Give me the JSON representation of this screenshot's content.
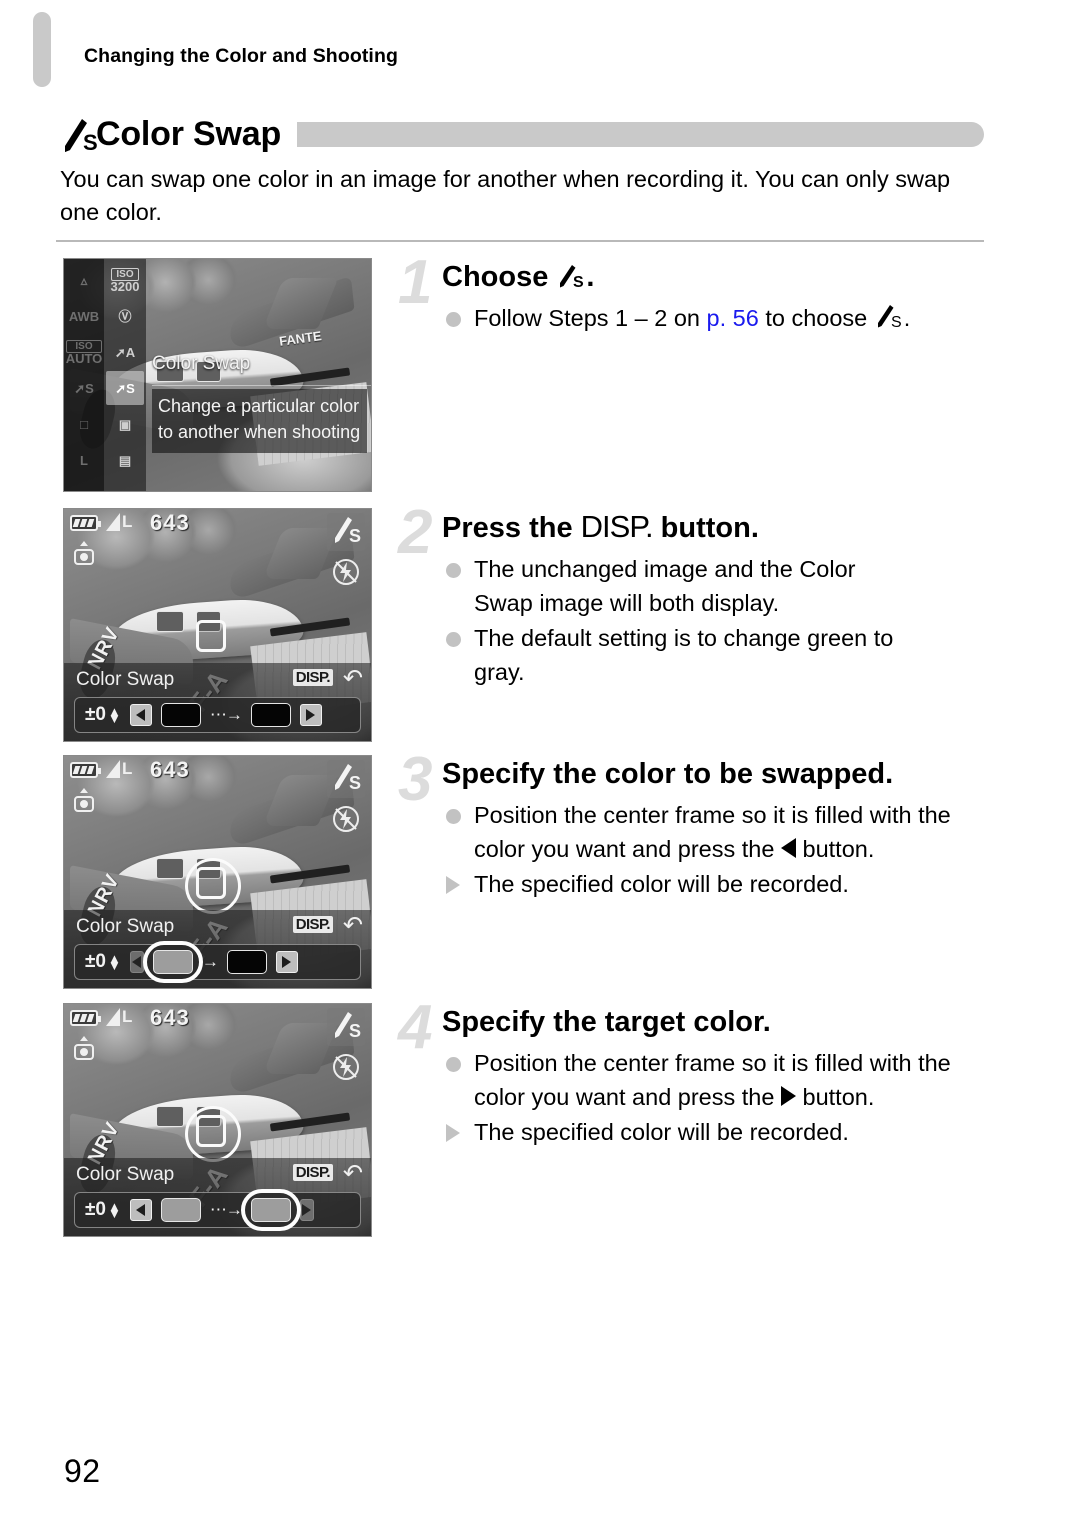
{
  "header": {
    "running_head": "Changing the Color and Shooting"
  },
  "section": {
    "icon_name": "color-swap-icon",
    "title": "Color Swap",
    "intro": "You can swap one color in an image for another when recording it. You can only swap one color."
  },
  "steps": [
    {
      "number": "1",
      "heading_prefix": "Choose",
      "heading_suffix": ".",
      "bullets": [
        {
          "type": "dot",
          "before": "Follow Steps 1 – 2 on ",
          "link": "p. 56",
          "middle": " to choose ",
          "after": "."
        }
      ]
    },
    {
      "number": "2",
      "heading_before": "Press the ",
      "heading_key": "DISP.",
      "heading_after": " button.",
      "bullets": [
        {
          "type": "dot",
          "text": "The unchanged image and the Color Swap image will both display."
        },
        {
          "type": "dot",
          "text": "The default setting is to change green to gray."
        }
      ]
    },
    {
      "number": "3",
      "heading": "Specify the color to be swapped.",
      "bullets": [
        {
          "type": "dot",
          "before": "Position the center frame so it is filled with the color you want and press the ",
          "button": "left-arrow",
          "after": " button."
        },
        {
          "type": "triangle",
          "text": "The specified color will be recorded."
        }
      ]
    },
    {
      "number": "4",
      "heading": "Specify the target color.",
      "bullets": [
        {
          "type": "dot",
          "before": "Position the center frame so it is filled with the color you want and press the ",
          "button": "right-arrow",
          "after": " button."
        },
        {
          "type": "triangle",
          "text": "The specified color will be recorded."
        }
      ]
    }
  ],
  "screenshots": [
    {
      "id": "menu-screen",
      "menu_column_left": [
        "AWB",
        "ISO AUTO",
        "swap-S",
        "single-frame",
        "L"
      ],
      "menu_column_right": [
        "ISO 3200",
        "D",
        "swap-A",
        "swap-S",
        "burst-1",
        "burst-2"
      ],
      "selected_item": "swap-S",
      "menu_title": "Color Swap",
      "menu_description": "Change a particular color to another when shooting"
    },
    {
      "id": "live-view-default",
      "battery": "battery-icon",
      "quality": "L",
      "shots_remaining": "643",
      "mode_icon": "color-swap-icon",
      "flash_icon": "flash-off-icon",
      "label": "Color Swap",
      "disp_badge": "DISP.",
      "return_icon": "return-arrow-icon",
      "ev": "±0",
      "source_swatch": "black",
      "target_swatch": "black",
      "selected_swatch": "none"
    },
    {
      "id": "live-view-source-selected",
      "battery": "battery-icon",
      "quality": "L",
      "shots_remaining": "643",
      "mode_icon": "color-swap-icon",
      "flash_icon": "flash-off-icon",
      "label": "Color Swap",
      "disp_badge": "DISP.",
      "return_icon": "return-arrow-icon",
      "ev": "±0",
      "source_swatch": "gray",
      "target_swatch": "black",
      "selected_swatch": "source"
    },
    {
      "id": "live-view-target-selected",
      "battery": "battery-icon",
      "quality": "L",
      "shots_remaining": "643",
      "mode_icon": "color-swap-icon",
      "flash_icon": "flash-off-icon",
      "label": "Color Swap",
      "disp_badge": "DISP.",
      "return_icon": "return-arrow-icon",
      "ev": "±0",
      "source_swatch": "gray",
      "target_swatch": "gray",
      "selected_swatch": "target"
    }
  ],
  "plane_markings": {
    "left_wing": "NRV",
    "fuselage": "F-A",
    "nose": "FANTE"
  },
  "footer": {
    "page_number": "92"
  },
  "colors": {
    "link": "#1a1aee",
    "accent_gray": "#c9c9c9",
    "step_number": "#dcdcdc"
  }
}
